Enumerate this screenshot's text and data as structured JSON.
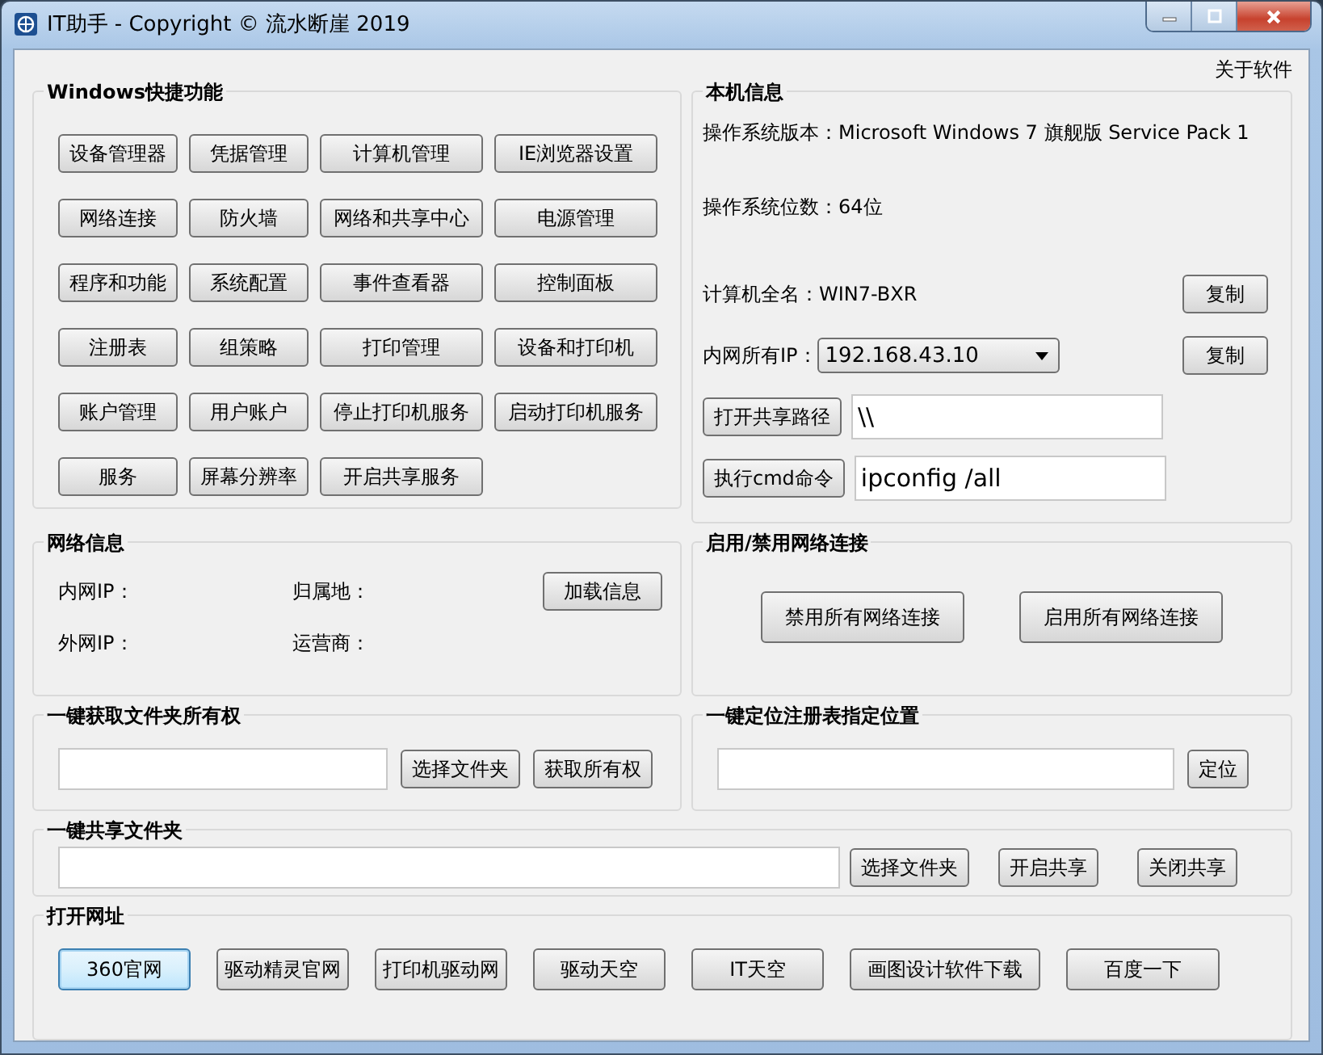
{
  "window": {
    "title": "IT助手 - Copyright © 流水断崖 2019"
  },
  "about_link": "关于软件",
  "quick_functions": {
    "title": "Windows快捷功能",
    "buttons": [
      "设备管理器",
      "凭据管理",
      "计算机管理",
      "IE浏览器设置",
      "网络连接",
      "防火墙",
      "网络和共享中心",
      "电源管理",
      "程序和功能",
      "系统配置",
      "事件查看器",
      "控制面板",
      "注册表",
      "组策略",
      "打印管理",
      "设备和打印机",
      "账户管理",
      "用户账户",
      "停止打印机服务",
      "启动打印机服务",
      "服务",
      "屏幕分辨率",
      "开启共享服务"
    ]
  },
  "machine_info": {
    "title": "本机信息",
    "os_version": "操作系统版本：Microsoft Windows 7 旗舰版  Service Pack 1",
    "os_bits": "操作系统位数：64位",
    "computer_name": "计算机全名：WIN7-BXR",
    "copy_name_button": "复制",
    "ip_label": "内网所有IP：",
    "ip_value": "192.168.43.10",
    "copy_ip_button": "复制",
    "share_path_button": "打开共享路径",
    "share_path_value": "\\\\",
    "cmd_button": "执行cmd命令",
    "cmd_value": "ipconfig /all"
  },
  "network_info": {
    "title": "网络信息",
    "labels": [
      "内网IP：",
      "归属地：",
      "外网IP：",
      "运营商："
    ],
    "button": "加载信息"
  },
  "network_toggle": {
    "title": "启用/禁用网络连接",
    "buttons": [
      "禁用所有网络连接",
      "启用所有网络连接"
    ]
  },
  "folder_ownership": {
    "title": "一键获取文件夹所有权",
    "buttons": [
      "选择文件夹",
      "获取所有权"
    ]
  },
  "registry_locate": {
    "title": "一键定位注册表指定位置",
    "button": "定位"
  },
  "share_folder": {
    "title": "一键共享文件夹",
    "buttons": [
      "选择文件夹",
      "开启共享",
      "关闭共享"
    ]
  },
  "open_url": {
    "title": "打开网址",
    "buttons": [
      {
        "label": "360官网",
        "focused": true
      },
      {
        "label": "驱动精灵官网",
        "focused": false
      },
      {
        "label": "打印机驱动网",
        "focused": false
      },
      {
        "label": "驱动天空",
        "focused": false
      },
      {
        "label": "IT天空",
        "focused": false
      },
      {
        "label": "画图设计软件下载",
        "focused": false
      },
      {
        "label": "百度一下",
        "focused": false
      }
    ]
  }
}
